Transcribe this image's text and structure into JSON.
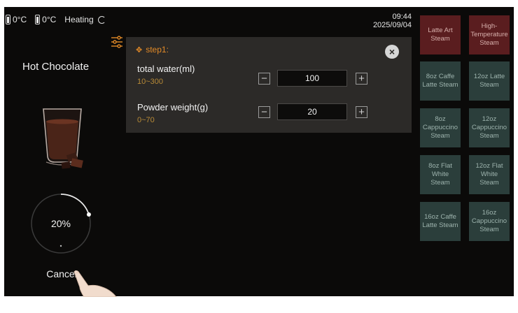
{
  "status": {
    "tank1": "0°C",
    "tank2": "0°C",
    "mode": "Heating",
    "time": "09:44",
    "date": "2025/09/04"
  },
  "drink": {
    "title": "Hot Chocolate",
    "progress_label": "20%",
    "progress": 0.2,
    "cancel_label": "Cancel"
  },
  "dialog": {
    "step_label": "step1:",
    "close_symbol": "×",
    "params": [
      {
        "label": "total water(ml)",
        "range": "10~300",
        "value": "100"
      },
      {
        "label": "Powder weight(g)",
        "range": "0~70",
        "value": "20"
      }
    ],
    "minus": "−",
    "plus": "+"
  },
  "tiles": [
    "Latte Art Steam",
    "High-Temperature Steam",
    "8oz Caffe Latte Steam",
    "12oz Latte Steam",
    "8oz Cappuccino Steam",
    "12oz Cappuccino Steam",
    "8oz Flat White Steam",
    "12oz Flat White Steam",
    "16oz Caffe Latte Steam",
    "16oz Cappuccino Steam"
  ],
  "colors": {
    "accent_orange": "#e28a27",
    "tile_teal": "#2b3e3b",
    "tile_red": "#5a1d1f",
    "dialog_bg": "#2c2a28"
  }
}
